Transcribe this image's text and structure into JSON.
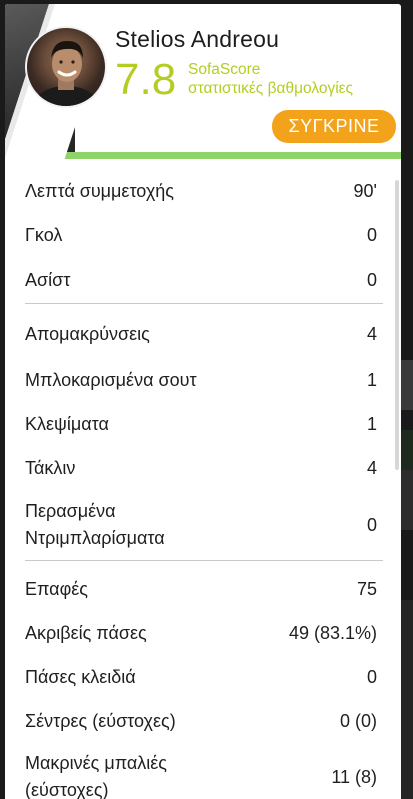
{
  "player": {
    "name": "Stelios Andreou",
    "rating": "7.8",
    "rating_source_line1": "SofaScore",
    "rating_source_line2": "στατιστικές βαθμολογίες",
    "compare_label": "ΣΥΓΚΡΙΝΕ"
  },
  "colors": {
    "rating": "#b5cd22",
    "compare_button": "#f3a31b",
    "accent_line": "#8fd46a"
  },
  "stat_groups": [
    [
      {
        "label": "Λεπτά συμμετοχής",
        "value": "90'"
      },
      {
        "label": "Γκολ",
        "value": "0"
      },
      {
        "label": "Ασίστ",
        "value": "0"
      }
    ],
    [
      {
        "label": "Απομακρύνσεις",
        "value": "4"
      },
      {
        "label": "Μπλοκαρισμένα σουτ",
        "value": "1"
      },
      {
        "label": "Κλεψίματα",
        "value": "1"
      },
      {
        "label": "Τάκλιν",
        "value": "4"
      },
      {
        "label": "Περασμένα Ντριμπλαρίσματα",
        "value": "0"
      }
    ],
    [
      {
        "label": "Επαφές",
        "value": "75"
      },
      {
        "label": "Ακριβείς πάσες",
        "value": "49 (83.1%)"
      },
      {
        "label": "Πάσες κλειδιά",
        "value": "0"
      },
      {
        "label": "Σέντρες (εύστοχες)",
        "value": "0 (0)"
      },
      {
        "label": "Μακρινές μπαλιές (εύστοχες)",
        "value": "11 (8)"
      }
    ]
  ]
}
